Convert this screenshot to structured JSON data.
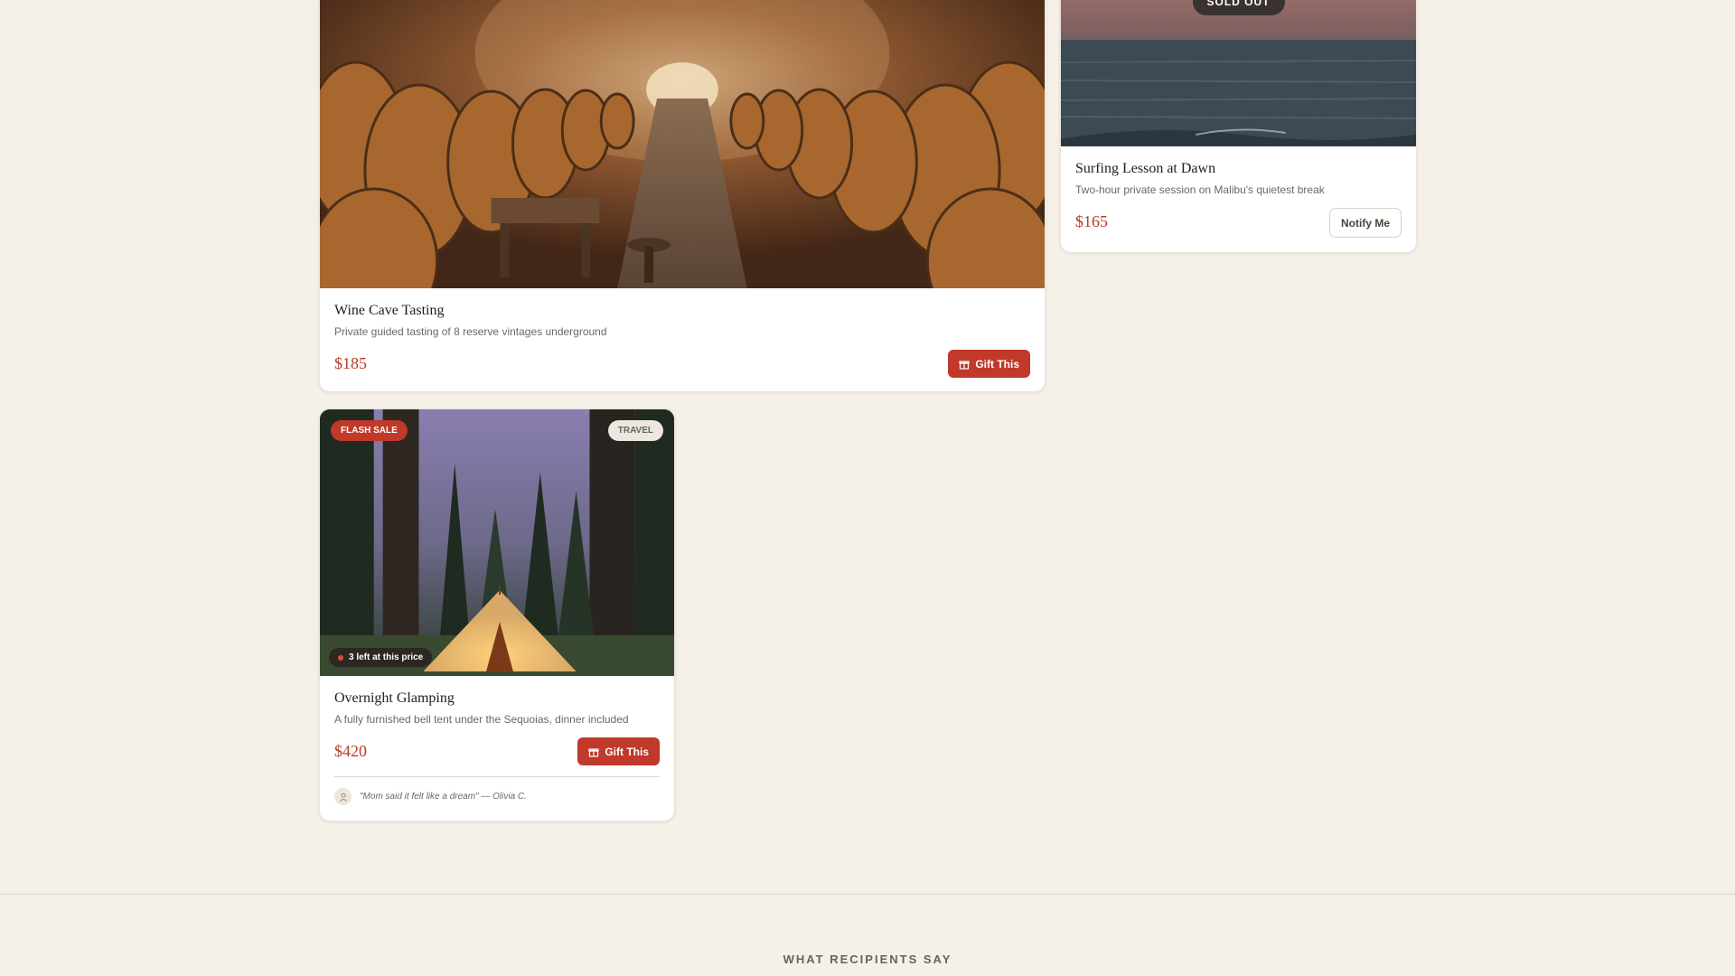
{
  "cards": [
    {
      "title": "Wine Cave Tasting",
      "description": "Private guided tasting of 8 reserve vintages underground",
      "price": "$185",
      "button_label": "Gift This"
    },
    {
      "badge": "SOLD OUT",
      "title": "Surfing Lesson at Dawn",
      "description": "Two-hour private session on Malibu's quietest break",
      "price": "$165",
      "button_label": "Notify Me"
    },
    {
      "badge_flash": "FLASH SALE",
      "badge_category": "TRAVEL",
      "stock_note": "3 left at this price",
      "title": "Overnight Glamping",
      "description": "A fully furnished bell tent under the Sequoias, dinner included",
      "price": "$420",
      "button_label": "Gift This",
      "testimonial": "\"Mom said it felt like a dream\" — Olivia C."
    }
  ],
  "testimonials_section": {
    "heading": "WHAT RECIPIENTS SAY"
  },
  "colors": {
    "page_background": "#f5f0e8",
    "accent": "#c0392b",
    "price": "#b63a2a",
    "badge_dark": "#3a3230"
  },
  "icons": {
    "gift": "gift-icon",
    "avatar": "person-icon"
  }
}
